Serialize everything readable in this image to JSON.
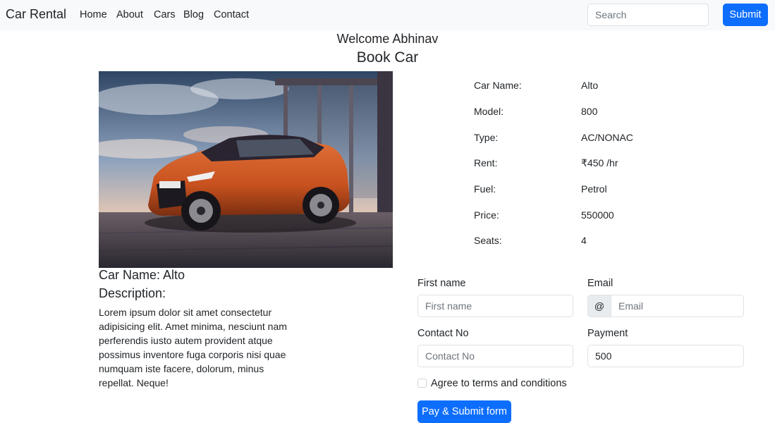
{
  "navbar": {
    "brand": "Car Rental",
    "links": [
      "Home",
      "About",
      "Cars",
      "Blog",
      "Contact"
    ],
    "search_placeholder": "Search",
    "submit_label": "Submit"
  },
  "page": {
    "welcome": "Welcome Abhinav",
    "title": "Book Car"
  },
  "car": {
    "name_heading": "Car Name: Alto",
    "description_heading": "Description:",
    "description": "Lorem ipsum dolor sit amet consectetur adipisicing elit. Amet minima, nesciunt nam perferendis iusto autem provident atque possimus inventore fuga corporis nisi quae numquam iste facere, dolorum, minus repellat. Neque!"
  },
  "specs": [
    {
      "label": "Car Name:",
      "value": "Alto"
    },
    {
      "label": "Model:",
      "value": "800"
    },
    {
      "label": "Type:",
      "value": "AC/NONAC"
    },
    {
      "label": "Rent:",
      "value": "₹450 /hr"
    },
    {
      "label": "Fuel:",
      "value": "Petrol"
    },
    {
      "label": "Price:",
      "value": "550000"
    },
    {
      "label": "Seats:",
      "value": "4"
    }
  ],
  "form": {
    "first_name_label": "First name",
    "first_name_placeholder": "First name",
    "email_label": "Email",
    "email_addon": "@",
    "email_placeholder": "Email",
    "contact_label": "Contact No",
    "contact_placeholder": "Contact No",
    "payment_label": "Payment",
    "payment_value": "500",
    "terms_label": "Agree to terms and conditions",
    "pay_button": "Pay & Submit form"
  },
  "colors": {
    "primary": "#0d6efd",
    "navbar_bg": "#f8f9fa",
    "car_body": "#c8521f"
  }
}
